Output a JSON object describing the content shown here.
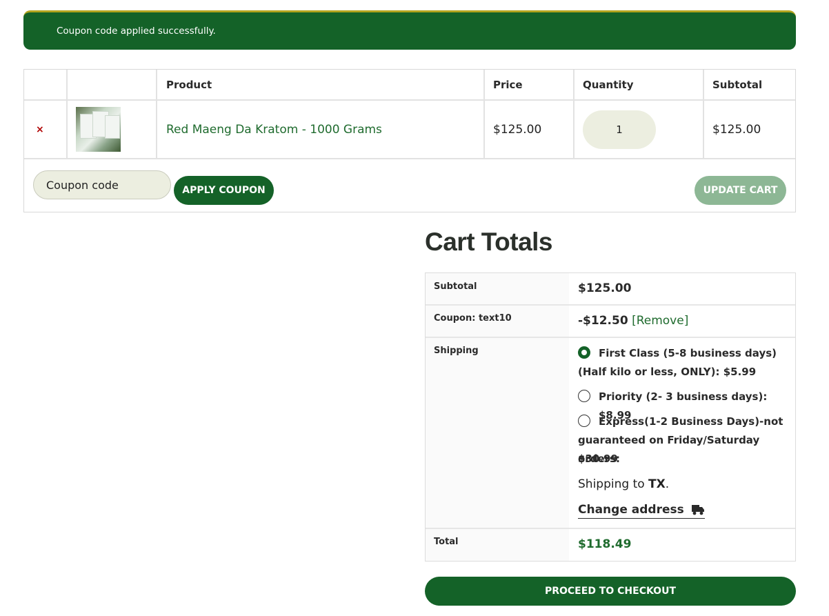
{
  "notice": {
    "message": "Coupon code applied successfully."
  },
  "cart": {
    "headers": {
      "product": "Product",
      "price": "Price",
      "quantity": "Quantity",
      "subtotal": "Subtotal"
    },
    "items": [
      {
        "remove": "×",
        "name": "Red Maeng Da Kratom - 1000 Grams",
        "price": "$125.00",
        "quantity": "1",
        "subtotal": "$125.00"
      }
    ],
    "coupon_placeholder": "Coupon code",
    "apply_label": "APPLY COUPON",
    "update_label": "UPDATE CART"
  },
  "totals": {
    "title": "Cart Totals",
    "subtotal_label": "Subtotal",
    "subtotal_value": "$125.00",
    "coupon_label": "Coupon: text10",
    "coupon_value": "-$12.50",
    "coupon_remove": "[Remove]",
    "shipping_label": "Shipping",
    "shipping_options": [
      {
        "line1": "First Class (5-8 business days)",
        "line2": "(Half kilo or less, ONLY): $5.99",
        "checked": true
      },
      {
        "line1": "Priority (2- 3 business days): $8.99",
        "checked": false
      },
      {
        "line1": "Express(1-2 Business Days)-not",
        "line2": "guaranteed on Friday/Saturday orders:",
        "line3": "$30.99",
        "checked": false
      }
    ],
    "shipping_to_prefix": "Shipping to ",
    "shipping_to_state": "TX",
    "shipping_to_suffix": ".",
    "change_address": "Change address",
    "total_label": "Total",
    "total_value": "$118.49"
  },
  "checkout_label": "PROCEED TO CHECKOUT",
  "colors": {
    "brand_green": "#146228",
    "link_green": "#1f6b2e",
    "input_bg": "#eceee0",
    "update_disabled": "#8db795"
  }
}
